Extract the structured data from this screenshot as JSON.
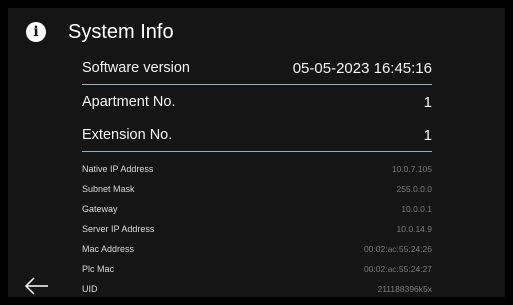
{
  "header": {
    "title": "System Info",
    "icon": "info-icon"
  },
  "primary": [
    {
      "label": "Software version",
      "value": "05-05-2023 16:45:16"
    },
    {
      "label": "Apartment No.",
      "value": "1"
    },
    {
      "label": "Extension No.",
      "value": "1"
    }
  ],
  "details": [
    {
      "label": "Native IP Address",
      "value": "10.0.7.105"
    },
    {
      "label": "Subnet Mask",
      "value": "255.0.0.0"
    },
    {
      "label": "Gateway",
      "value": "10.0.0.1"
    },
    {
      "label": "Server IP Address",
      "value": "10.0.14.9"
    },
    {
      "label": "Mac Address",
      "value": "00:02:ac:55:24:26"
    },
    {
      "label": "Plc Mac",
      "value": "00:02:ac:55:24:27"
    },
    {
      "label": "UID",
      "value": "211188396k5x"
    }
  ],
  "navigation": {
    "back_icon": "arrow-left-icon"
  },
  "colors": {
    "background": "#000000",
    "panel": "#151515",
    "divider": "#8fb3cc",
    "primary_text": "#f2f2f2",
    "muted_value": "#7a7a7a"
  }
}
